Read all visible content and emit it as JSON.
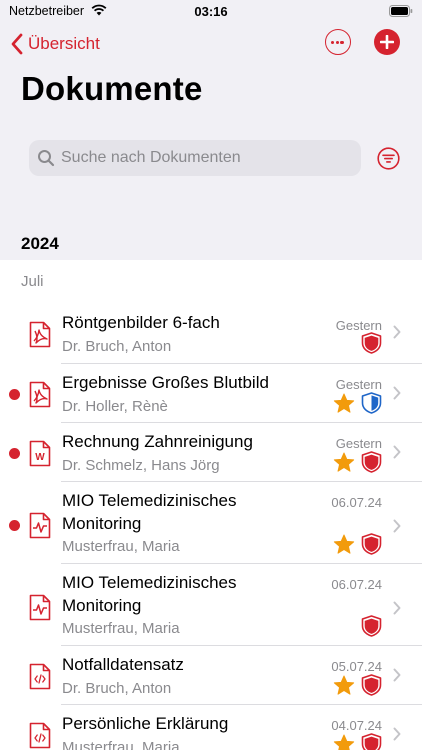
{
  "status_bar": {
    "carrier": "Netzbetreiber",
    "time": "03:16"
  },
  "nav": {
    "back_label": "Übersicht"
  },
  "page": {
    "title": "Dokumente"
  },
  "search": {
    "placeholder": "Suche nach Dokumenten"
  },
  "section": {
    "year": "2024",
    "month": "Juli"
  },
  "accent_color": "#d5232f",
  "documents": [
    {
      "title": "Röntgenbilder 6-fach",
      "subtitle": "Dr. Bruch, Anton",
      "date": "Gestern",
      "icon": "pdf-icon",
      "unread": false,
      "starred": false,
      "shield": "red-shield-icon"
    },
    {
      "title": "Ergebnisse Großes Blutbild",
      "subtitle": "Dr. Holler, Rènè",
      "date": "Gestern",
      "icon": "pdf-icon",
      "unread": true,
      "starred": true,
      "shield": "blue-shield-icon"
    },
    {
      "title": "Rechnung Zahnreinigung",
      "subtitle": "Dr. Schmelz, Hans Jörg",
      "date": "Gestern",
      "icon": "word-document-icon",
      "unread": true,
      "starred": true,
      "shield": "red-shield-icon"
    },
    {
      "title": "MIO Telemedizinisches Monitoring",
      "subtitle": "Musterfrau, Maria",
      "date": "06.07.24",
      "icon": "monitoring-document-icon",
      "unread": true,
      "starred": true,
      "shield": "red-shield-icon"
    },
    {
      "title": "MIO Telemedizinisches Monitoring",
      "subtitle": "Musterfrau, Maria",
      "date": "06.07.24",
      "icon": "monitoring-document-icon",
      "unread": false,
      "starred": false,
      "shield": "red-shield-icon"
    },
    {
      "title": "Notfalldatensatz",
      "subtitle": "Dr. Bruch, Anton",
      "date": "05.07.24",
      "icon": "code-document-icon",
      "unread": false,
      "starred": true,
      "shield": "red-shield-icon"
    },
    {
      "title": "Persönliche Erklärung",
      "subtitle": "Musterfrau, Maria",
      "date": "04.07.24",
      "icon": "code-document-icon",
      "unread": false,
      "starred": true,
      "shield": "red-shield-icon"
    }
  ]
}
